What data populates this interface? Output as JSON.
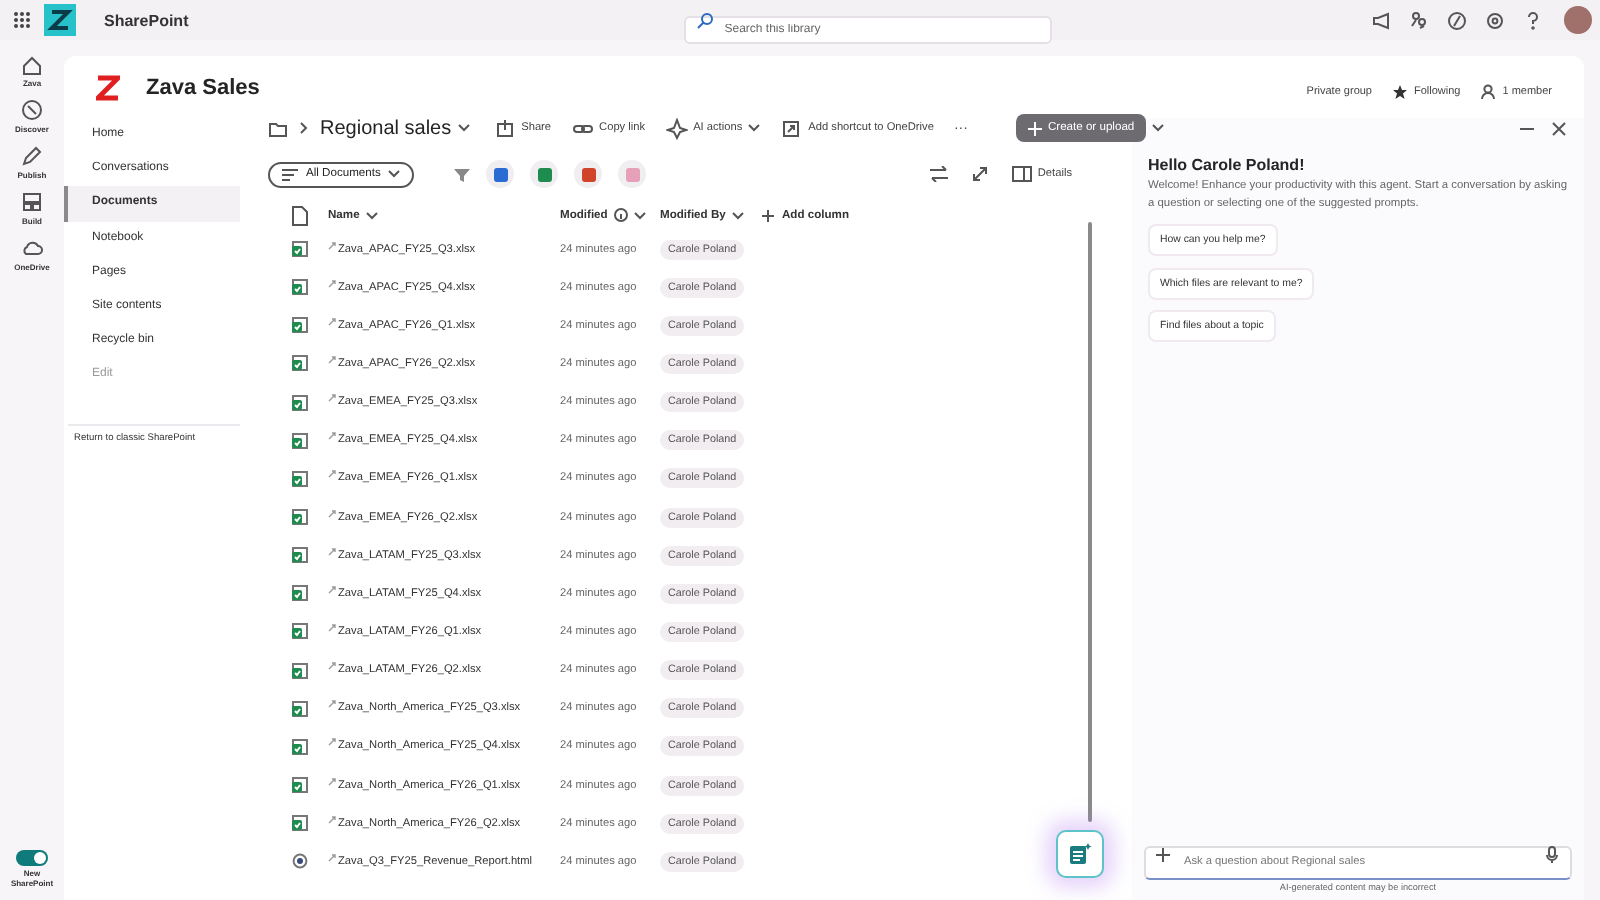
{
  "top_bar": {
    "app_name": "SharePoint",
    "search": {
      "placeholder": "Search this library"
    }
  },
  "rail": [
    {
      "label": "Zava",
      "kind": "home"
    },
    {
      "label": "Discover",
      "kind": "discover"
    },
    {
      "label": "Publish",
      "kind": "publish"
    },
    {
      "label": "Build",
      "kind": "build"
    },
    {
      "label": "OneDrive",
      "kind": "cloud"
    }
  ],
  "rail_toggle": {
    "label": "New SharePoint",
    "on": true
  },
  "site": {
    "title": "Zava Sales",
    "meta": [
      {
        "kind": "text",
        "label": "Private group"
      },
      {
        "kind": "star",
        "label": "Following"
      },
      {
        "kind": "person",
        "label": "1 member"
      }
    ]
  },
  "nav": {
    "items": [
      {
        "label": "Home",
        "selected": false,
        "disabled": false
      },
      {
        "label": "Conversations",
        "selected": false,
        "disabled": false
      },
      {
        "label": "Documents",
        "selected": true,
        "disabled": false
      },
      {
        "label": "Notebook",
        "selected": false,
        "disabled": false
      },
      {
        "label": "Pages",
        "selected": false,
        "disabled": false
      },
      {
        "label": "Site contents",
        "selected": false,
        "disabled": false
      },
      {
        "label": "Recycle bin",
        "selected": false,
        "disabled": false
      },
      {
        "label": "Edit",
        "selected": false,
        "disabled": true
      }
    ],
    "footer_link": "Return to classic SharePoint"
  },
  "library": {
    "title": "Regional sales",
    "commands": [
      {
        "kind": "share",
        "label": "Share"
      },
      {
        "kind": "link",
        "label": "Copy link"
      },
      {
        "kind": "ai",
        "label": "AI actions"
      },
      {
        "kind": "shortcut",
        "label": "Add shortcut to OneDrive"
      }
    ],
    "more": "···",
    "create_button": "Create or upload",
    "view": "All Documents",
    "details": "Details",
    "columns": [
      "Name",
      "Modified",
      "Modified By",
      "Add column"
    ],
    "rows": [
      {
        "kind": "excel",
        "name": "Zava_APAC_FY25_Q3.xlsx",
        "modified": "24 minutes ago",
        "by": "Carole Poland"
      },
      {
        "kind": "excel",
        "name": "Zava_APAC_FY25_Q4.xlsx",
        "modified": "24 minutes ago",
        "by": "Carole Poland"
      },
      {
        "kind": "excel",
        "name": "Zava_APAC_FY26_Q1.xlsx",
        "modified": "24 minutes ago",
        "by": "Carole Poland"
      },
      {
        "kind": "excel",
        "name": "Zava_APAC_FY26_Q2.xlsx",
        "modified": "24 minutes ago",
        "by": "Carole Poland"
      },
      {
        "kind": "excel",
        "name": "Zava_EMEA_FY25_Q3.xlsx",
        "modified": "24 minutes ago",
        "by": "Carole Poland"
      },
      {
        "kind": "excel",
        "name": "Zava_EMEA_FY25_Q4.xlsx",
        "modified": "24 minutes ago",
        "by": "Carole Poland"
      },
      {
        "kind": "excel",
        "name": "Zava_EMEA_FY26_Q1.xlsx",
        "modified": "24 minutes ago",
        "by": "Carole Poland"
      },
      {
        "kind": "excel",
        "name": "Zava_EMEA_FY26_Q2.xlsx",
        "modified": "24 minutes ago",
        "by": "Carole Poland"
      },
      {
        "kind": "excel",
        "name": "Zava_LATAM_FY25_Q3.xlsx",
        "modified": "24 minutes ago",
        "by": "Carole Poland"
      },
      {
        "kind": "excel",
        "name": "Zava_LATAM_FY25_Q4.xlsx",
        "modified": "24 minutes ago",
        "by": "Carole Poland"
      },
      {
        "kind": "excel",
        "name": "Zava_LATAM_FY26_Q1.xlsx",
        "modified": "24 minutes ago",
        "by": "Carole Poland"
      },
      {
        "kind": "excel",
        "name": "Zava_LATAM_FY26_Q2.xlsx",
        "modified": "24 minutes ago",
        "by": "Carole Poland"
      },
      {
        "kind": "excel",
        "name": "Zava_North_America_FY25_Q3.xlsx",
        "modified": "24 minutes ago",
        "by": "Carole Poland"
      },
      {
        "kind": "excel",
        "name": "Zava_North_America_FY25_Q4.xlsx",
        "modified": "24 minutes ago",
        "by": "Carole Poland"
      },
      {
        "kind": "excel",
        "name": "Zava_North_America_FY26_Q1.xlsx",
        "modified": "24 minutes ago",
        "by": "Carole Poland"
      },
      {
        "kind": "excel",
        "name": "Zava_North_America_FY26_Q2.xlsx",
        "modified": "24 minutes ago",
        "by": "Carole Poland"
      },
      {
        "kind": "html",
        "name": "Zava_Q3_FY25_Revenue_Report.html",
        "modified": "24 minutes ago",
        "by": "Carole Poland"
      }
    ]
  },
  "chat": {
    "title": "Hello Carole Poland!",
    "intro": "Welcome! Enhance your productivity with this agent. Start a conversation by asking a question or selecting one of the suggested prompts.",
    "prompts": [
      "How can you help me?",
      "Which files are relevant to me?",
      "Find files about a topic"
    ],
    "input": {
      "placeholder": "Ask a question about Regional sales"
    },
    "disclaimer": "AI-generated content may be incorrect"
  }
}
